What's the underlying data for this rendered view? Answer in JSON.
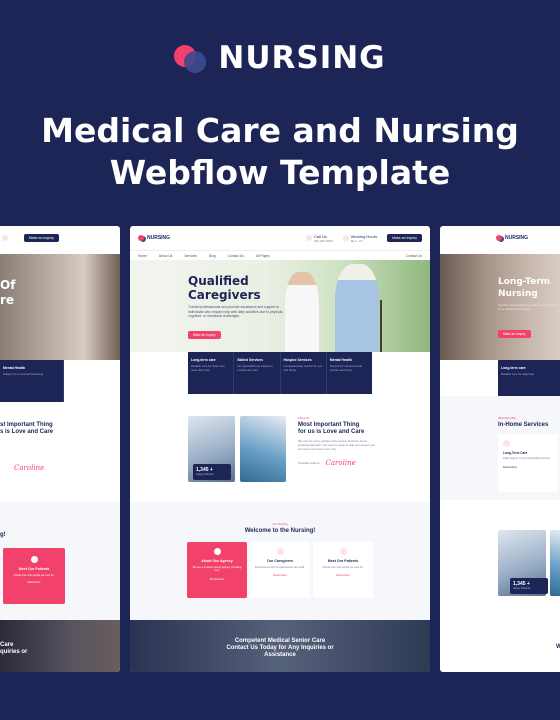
{
  "brand": {
    "name": "NURSING",
    "accent": "#f2426b",
    "secondary": "#3d4a8f",
    "background": "#1c2556"
  },
  "headline": {
    "line1": "Medical Care and Nursing",
    "line2": "Webflow Template"
  },
  "center": {
    "logo": "NURSING",
    "contact1": {
      "label": "Call Us",
      "value": "(00) 000-0000"
    },
    "contact2": {
      "label": "Working Hours",
      "value": "Mon - Fri"
    },
    "top_button": "Make an Inquiry",
    "nav": [
      "Home",
      "About Us",
      "Services",
      "Blog",
      "Contact Us",
      "All Pages"
    ],
    "nav_right": "Contact Us",
    "hero_title_1": "Qualified",
    "hero_title_2": "Caregivers",
    "hero_sub": "Trained professionals who provide assistance and support to individuals who require help with daily activities due to physical, cognitive, or emotional challenges.",
    "hero_button": "Make an Inquiry",
    "services": [
      {
        "title": "Long-term care",
        "desc": "Reliable care for those who need daily help"
      },
      {
        "title": "Skilled Services",
        "desc": "Our specialists are trained to provide any care"
      },
      {
        "title": "Hospice Services",
        "desc": "Compassionate comfort for you and family"
      },
      {
        "title": "Mental Health",
        "desc": "Support for emotional and mental well-being"
      }
    ],
    "stat_number": "1,345 +",
    "stat_label": "Happy Patients",
    "about_kicker": "About Us",
    "about_title_1": "Most Important Thing",
    "about_title_2": "for us is Love and Care",
    "about_body": "We care for every resident with respect, kindness and a personal approach. Our team is ready to help and support you and your loved ones every day.",
    "president": "President Name",
    "signature": "Caroline",
    "welcome_kicker": "Our Nursing",
    "welcome_title": "Welcome to the Nursing!",
    "welcome_cards": [
      {
        "title": "About Our Agency",
        "desc": "We are a trusted nursing agency providing care.",
        "more": "All Services"
      },
      {
        "title": "Our Caregivers",
        "desc": "Experienced and compassionate care staff.",
        "more": "Read More"
      },
      {
        "title": "Meet Our Patients",
        "desc": "Stories from the people we care for.",
        "more": "Read More"
      }
    ],
    "cta_line1": "Competent Medical Senior Care",
    "cta_line2": "Contact Us Today for Any Inquiries or",
    "cta_line3": "Assistance"
  },
  "left": {
    "top_button": "Make an Inquiry",
    "hero_big_1": "Of",
    "hero_big_2": "re",
    "about_title_1": "st Important Thing",
    "about_title_2": "s is Love and Care",
    "signature": "Caroline",
    "welcome": "g!",
    "card_title": "Meet Our Patients",
    "card_desc": "Stories from the people we care for.",
    "card_more": "Read More",
    "cta_1": "Care",
    "cta_2": "quiries or",
    "svc_title": "Mental Health",
    "svc_desc": "Support for emotional well-being"
  },
  "right": {
    "logo": "NURSING",
    "nav": [
      "Home",
      "About Us",
      "Services",
      "Blog"
    ],
    "hero_big_1": "Long-Term",
    "hero_big_2": "Nursing",
    "hero_sub": "Nursing care provided to a loved one at home or in our facility with comfort.",
    "hero_button": "Make an Inquiry",
    "svc_title": "Long-term care",
    "svc_desc": "Reliable care for daily help",
    "home_kicker": "What We Offer",
    "home_title": "In-Home Services",
    "box_title": "Long-Term Care",
    "box_desc": "Daily support to live comfortably at home.",
    "box_more": "Read More",
    "stat_number": "1,345 +",
    "stat_label": "Happy Patients",
    "w": "W"
  }
}
